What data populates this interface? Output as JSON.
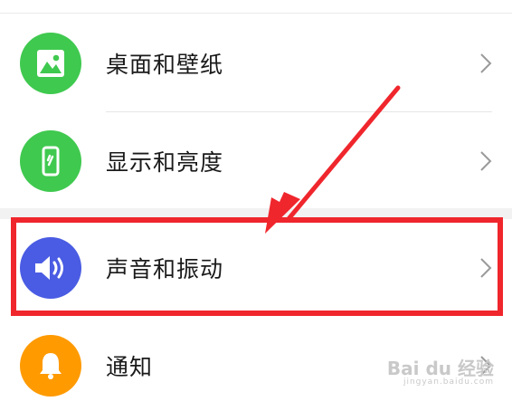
{
  "settings": {
    "items": [
      {
        "label": "桌面和壁纸",
        "icon": "image-icon",
        "color": "#3fc94f"
      },
      {
        "label": "显示和亮度",
        "icon": "phone-display-icon",
        "color": "#3fc94f"
      },
      {
        "label": "声音和振动",
        "icon": "speaker-icon",
        "color": "#4a5ce3"
      },
      {
        "label": "通知",
        "icon": "bell-icon",
        "color": "#ff9a00"
      }
    ]
  },
  "annotation": {
    "highlight_color": "#f0262d"
  },
  "watermark": {
    "brand": "Bai du 经验",
    "url": "jingyan.baidu.com"
  }
}
